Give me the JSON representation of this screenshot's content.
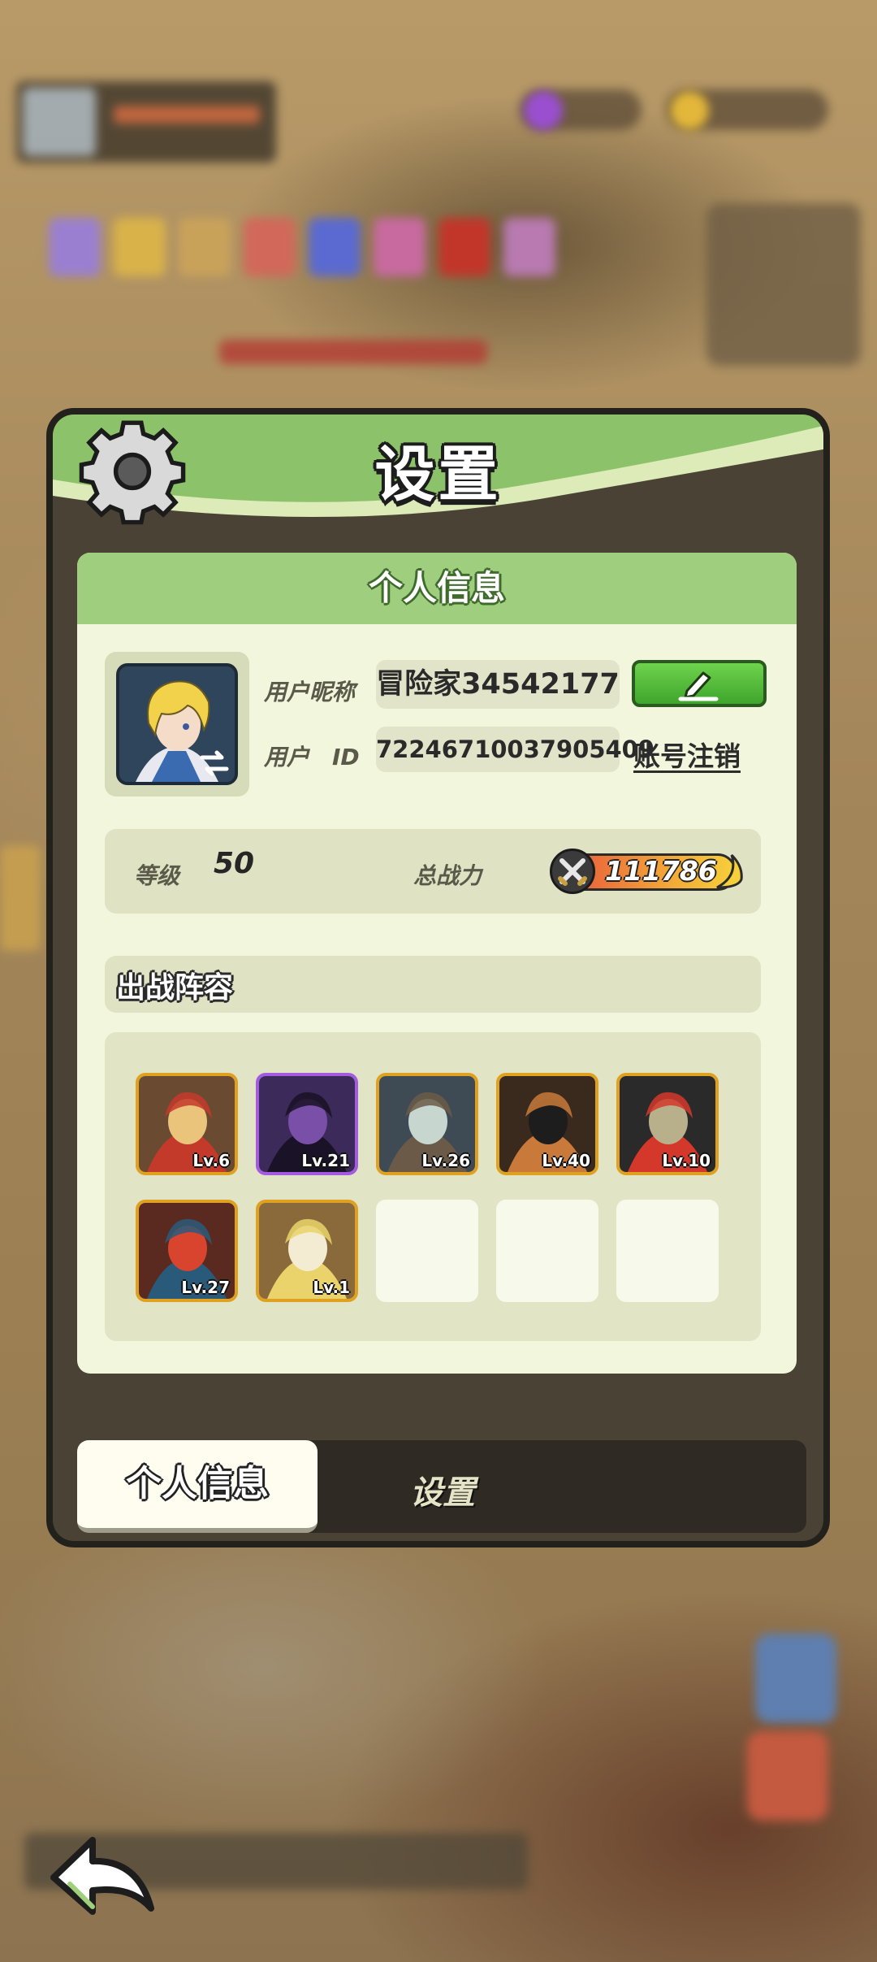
{
  "dialog": {
    "title": "设置",
    "panel_title": "个人信息"
  },
  "profile": {
    "nickname_label": "用户昵称",
    "nickname": "冒险家34542177",
    "id_label": "用户　ID",
    "user_id": "72246710037905409",
    "cancel_account": "账号注销"
  },
  "stats": {
    "level_label": "等级",
    "level": "50",
    "power_label": "总战力",
    "power": "111786"
  },
  "team": {
    "title": "出战阵容",
    "heroes": [
      {
        "level": "Lv.6",
        "colors": [
          "#6a4a30",
          "#e9c47a",
          "#c43a2a"
        ],
        "frame": "gold"
      },
      {
        "level": "Lv.21",
        "colors": [
          "#3b2a5a",
          "#7a4fa8",
          "#1a1226"
        ],
        "frame": "purple"
      },
      {
        "level": "Lv.26",
        "colors": [
          "#3e4a54",
          "#c8d6d0",
          "#6b5a48"
        ],
        "frame": "gold"
      },
      {
        "level": "Lv.40",
        "colors": [
          "#3a2a1e",
          "#1d1d1d",
          "#c97a3a"
        ],
        "frame": "gold"
      },
      {
        "level": "Lv.10",
        "colors": [
          "#2a2a2a",
          "#b8b08a",
          "#d4382a"
        ],
        "frame": "gold"
      },
      {
        "level": "Lv.27",
        "colors": [
          "#5a2a20",
          "#d8442e",
          "#2a5a7a"
        ],
        "frame": "gold"
      },
      {
        "level": "Lv.1",
        "colors": [
          "#8a6a3a",
          "#f3ecd2",
          "#e9d36a"
        ],
        "frame": "gold"
      }
    ]
  },
  "tabs": {
    "active": "个人信息",
    "inactive": "设置"
  },
  "icons": {
    "settings": "gear-icon",
    "edit": "pencil-icon",
    "power": "crossed-swords-icon",
    "switch": "swap-arrows-icon",
    "back": "back-arrow-icon"
  }
}
